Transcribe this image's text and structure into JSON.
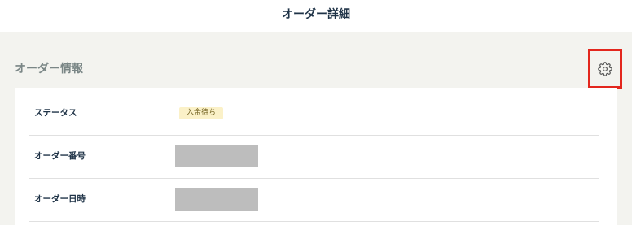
{
  "header": {
    "title": "オーダー詳細"
  },
  "section": {
    "title": "オーダー情報",
    "settings_icon": "gear-icon"
  },
  "rows": [
    {
      "label": "ステータス",
      "status_badge": "入金待ち"
    },
    {
      "label": "オーダー番号",
      "value": ""
    },
    {
      "label": "オーダー日時",
      "value": ""
    }
  ],
  "colors": {
    "badge_bg": "#fbf1c8",
    "highlight_border": "#e3261d",
    "redaction": "#bdbdbd"
  }
}
